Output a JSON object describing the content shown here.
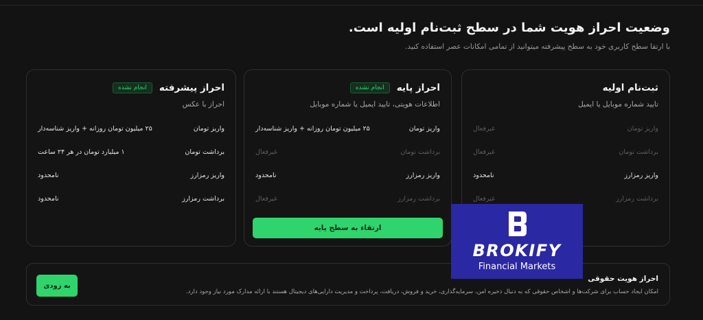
{
  "header": {
    "title": "وضعیت احراز هویت شما در سطح ثبت‌نام اولیه است.",
    "subtitle": "با ارتقا سطح کاربری خود به سطح پیشرفته میتوانید از تمامی امکانات عصر استفاده کنید."
  },
  "cards": [
    {
      "title": "ثبت‌نام اولیه",
      "badge": "",
      "subtitle": "تایید شماره موبایل یا ایمیل",
      "rows": [
        {
          "label": "واریز تومان",
          "value": "غیرفعال",
          "dim": true
        },
        {
          "label": "برداشت تومان",
          "value": "غیرفعال",
          "dim": true
        },
        {
          "label": "واریز رمزارز",
          "value": "نامحدود",
          "dim": false
        },
        {
          "label": "برداشت رمزارز",
          "value": "غیرفعال",
          "dim": true
        }
      ]
    },
    {
      "title": "احراز پایه",
      "badge": "انجام نشده",
      "subtitle": "اطلاعات هویتی، تایید ایمیل یا شماره موبایل",
      "rows": [
        {
          "label": "واریز تومان",
          "value": "۲۵ میلیون تومان روزانه + واریز شناسه‌دار",
          "dim": false
        },
        {
          "label": "برداشت تومان",
          "value": "غیرفعال",
          "dim": true
        },
        {
          "label": "واریز رمزارز",
          "value": "نامحدود",
          "dim": false
        },
        {
          "label": "برداشت رمزارز",
          "value": "غیرفعال",
          "dim": true
        }
      ],
      "button": "ارتقاء به سطح پایه"
    },
    {
      "title": "احراز پیشرفته",
      "badge": "انجام نشده",
      "subtitle": "احراز با عکس",
      "rows": [
        {
          "label": "واریز تومان",
          "value": "۲۵ میلیون تومان روزانه + واریز شناسه‌دار",
          "dim": false
        },
        {
          "label": "برداشت تومان",
          "value": "۱ میلیارد تومان در هر ۲۴ ساعت",
          "dim": false
        },
        {
          "label": "واریز رمزارز",
          "value": "نامحدود",
          "dim": false
        },
        {
          "label": "برداشت رمزارز",
          "value": "نامحدود",
          "dim": false
        }
      ]
    }
  ],
  "legal": {
    "title": "احراز هویت حقوقی",
    "description": "امکان ایجاد حساب برای شرکت‌ها و اشخاص حقوقی که به دنبال ذخیره امن، سرمایه‌گذاری، خرید و فروش، دریافت، پرداخت و مدیریت دارایی‌های دیجیتال هستند با ارائه مدارک مورد نیاز وجود دارد.",
    "button": "به زودی"
  },
  "watermark": {
    "name": "BROKIFY",
    "tagline": "Financial Markets",
    "color": "#2b28a3"
  },
  "colors": {
    "accent": "#2fd46c",
    "background": "#131313"
  }
}
